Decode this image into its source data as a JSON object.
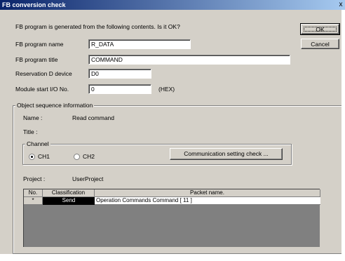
{
  "window": {
    "title": "FB conversion check",
    "close_glyph": "x"
  },
  "message": "FB program is generated from the following contents. Is it OK?",
  "buttons": {
    "ok": "OK",
    "cancel": "Cancel"
  },
  "fields": {
    "program_name": {
      "label": "FB program name",
      "value": "R_DATA"
    },
    "program_title": {
      "label": "FB program title",
      "value": "COMMAND"
    },
    "reservation": {
      "label": "Reservation D device",
      "value": "D0"
    },
    "module_start": {
      "label": "Module start I/O No.",
      "value": "0",
      "suffix": "(HEX)"
    }
  },
  "object_sequence": {
    "group_title": "Object sequence information",
    "name_label": "Name :",
    "name_value": "Read command",
    "title_label": "Title  :",
    "channel": {
      "group_title": "Channel",
      "options": [
        "CH1",
        "CH2"
      ],
      "selected": "CH1",
      "comm_button": "Communication setting check ..."
    },
    "project_label": "Project :",
    "project_value": "UserProject"
  },
  "table": {
    "headers": [
      "No.",
      "Classification",
      "Packet name."
    ],
    "rows": [
      {
        "no": "*",
        "classification": "Send",
        "packet": "Operation Commands Command [ 11 ]"
      }
    ]
  },
  "colors": {
    "title_start": "#0a246a",
    "title_end": "#a6caf0",
    "face": "#d4d0c8",
    "selected_cell": "#000000"
  }
}
